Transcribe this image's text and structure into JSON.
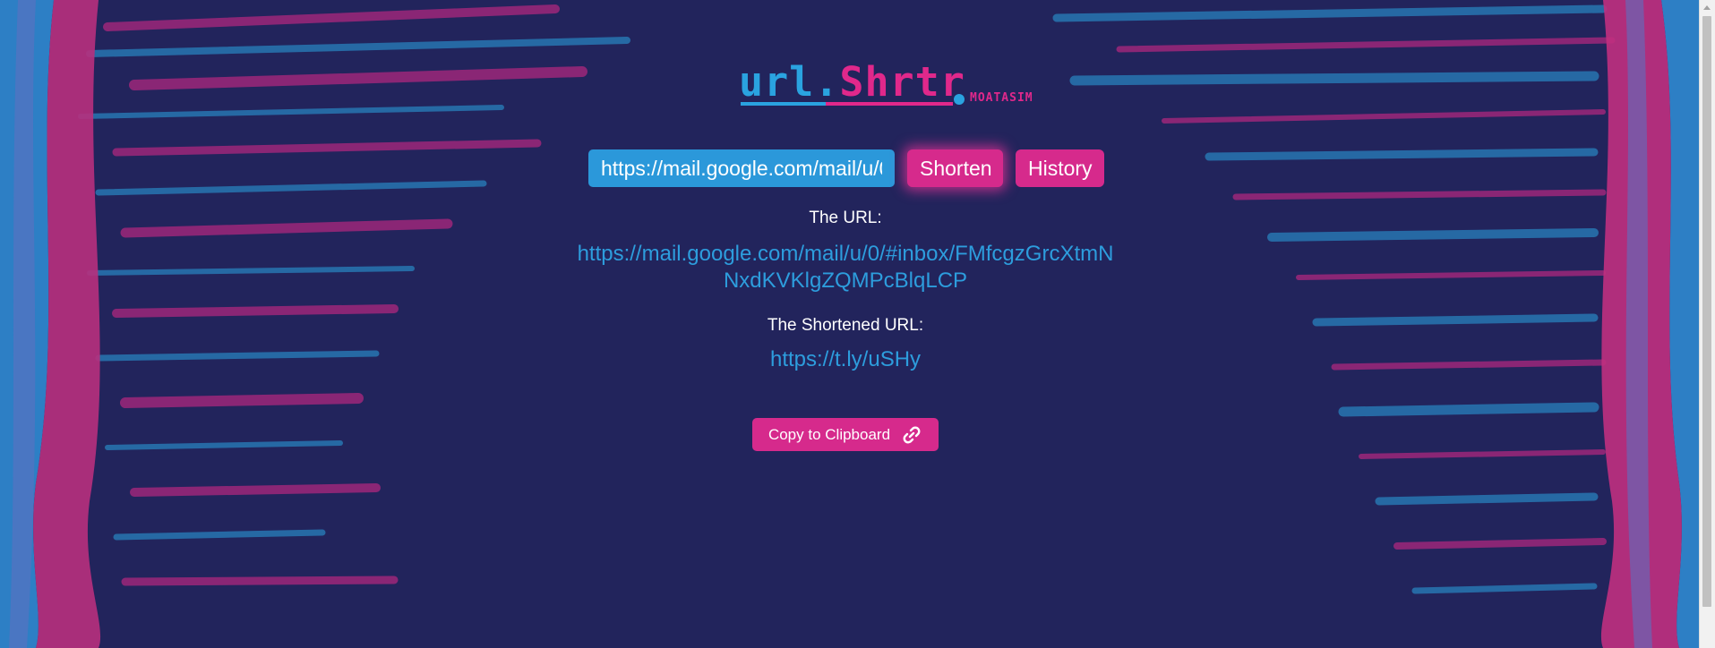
{
  "logo": {
    "part_a": "url.",
    "part_b": "Shrtr",
    "author": "MOATASIM"
  },
  "form": {
    "input_value": "https://mail.google.com/mail/u/0/#inbox/FMfcgzGrcXtmNNxdKVKlgZQMPcBlqLCP",
    "shorten_label": "Shorten",
    "history_label": "History"
  },
  "result": {
    "url_label": "The URL:",
    "url_value": "https://mail.google.com/mail/u/0/#inbox/FMfcgzGrcXtmNNxdKVKlgZQMPcBlqLCP",
    "short_label": "The Shortened URL:",
    "short_value": "https://t.ly/uSHy",
    "copy_label": "Copy to Clipboard",
    "copy_icon": "link-icon"
  },
  "colors": {
    "background": "#22245c",
    "accent_blue": "#2b98da",
    "accent_pink": "#d62a8c"
  }
}
